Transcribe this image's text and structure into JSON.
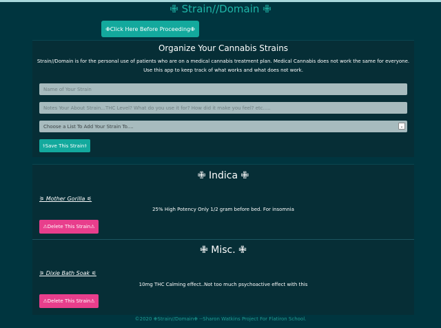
{
  "header": {
    "brand": "✙ Strain//Domain ✙",
    "proceed_button": "✙Click Here Before Proceeding✙"
  },
  "form": {
    "title": "Organize Your Cannabis Strains",
    "intro": "Strain//Domain is for the personal use of patients who are on a medical cannabis treatment plan. Medical Cannabis does not work the same for everyone. Use this app to keep track of what works and what does not work.",
    "name_placeholder": "Name of Your Strain",
    "notes_placeholder": "Notes Your About Strain...THC Level? What do you use it for? How did it make you feel? etc.....",
    "list_select_value": "Choose a List To Add Your Strain To....",
    "save_button": "⚕Save This Strain⚕"
  },
  "lists": [
    {
      "title": "✙ Indica ✙",
      "strains": [
        {
          "name": "⚞ Mother Gorilla ⚟",
          "notes": "25% High Potency Only 1/2 gram before bed. For insomnia",
          "delete_label": "⚠Delete This Strain⚠"
        }
      ]
    },
    {
      "title": "✙ Misc. ✙",
      "strains": [
        {
          "name": "⚞ Dixie Bath Soak ⚟",
          "notes": "10mg THC Calming effect..Not too much psychoactive effect with this",
          "delete_label": "⚠Delete This Strain⚠"
        }
      ]
    }
  ],
  "footer": "©2020 ✙Strain//Domain✙ --Sharon Watkins Project For Flatiron School."
}
